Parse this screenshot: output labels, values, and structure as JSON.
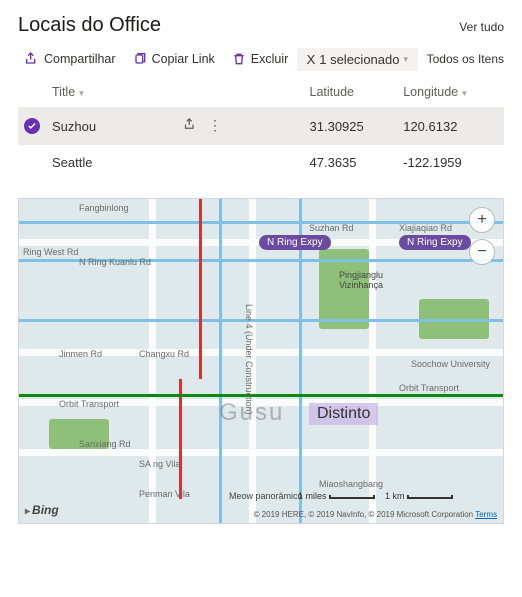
{
  "header": {
    "title": "Locais do Office",
    "see_all": "Ver tudo"
  },
  "toolbar": {
    "share": "Compartilhar",
    "copy_link": "Copiar Link",
    "delete": "Excluir",
    "selected": "1 selecionado",
    "views": "Todos os Itens"
  },
  "table": {
    "columns": {
      "title": "Title",
      "latitude": "Latitude",
      "longitude": "Longitude"
    },
    "rows": [
      {
        "title": "Suzhou",
        "latitude": "31.30925",
        "longitude": "120.6132",
        "selected": true
      },
      {
        "title": "Seattle",
        "latitude": "47.3635",
        "longitude": "-122.1959",
        "selected": false
      }
    ]
  },
  "map": {
    "provider": "Bing",
    "ring_expwy": "N Ring Expy",
    "ring_west": "Ring West Rd",
    "kuanlu": "N Ring Kuanlu Rd",
    "fangbin": "Fangbinlong",
    "suzhan": "Suzhan Rd",
    "xiajiaqiao": "Xiajiaqiao Rd",
    "under_construction": "(Under Construction)",
    "line4_note": "Line 4 (Under Construction)",
    "jinmen": "Jinmen Rd",
    "changxu": "Changxu Rd",
    "orbit": "Orbit Transport",
    "sanxiang": "Sanxiang Rd",
    "sang": "SA ng Vila",
    "penman": "Penman Vila",
    "miaoshang": "Miaoshangbang",
    "pingjiang": "Pingjianglu",
    "vizinhanca": "Vizinhança",
    "soochow": "Soochow University",
    "gusu": "Gusu",
    "distinct": "Distinto",
    "meow": "Meow panorâmico",
    "scale_miles": "1 miles",
    "scale_km": "1 km",
    "copyright": "© 2019 HERE, © 2019 NavInfo, © 2019 Microsoft Corporation",
    "terms": "Terms"
  }
}
